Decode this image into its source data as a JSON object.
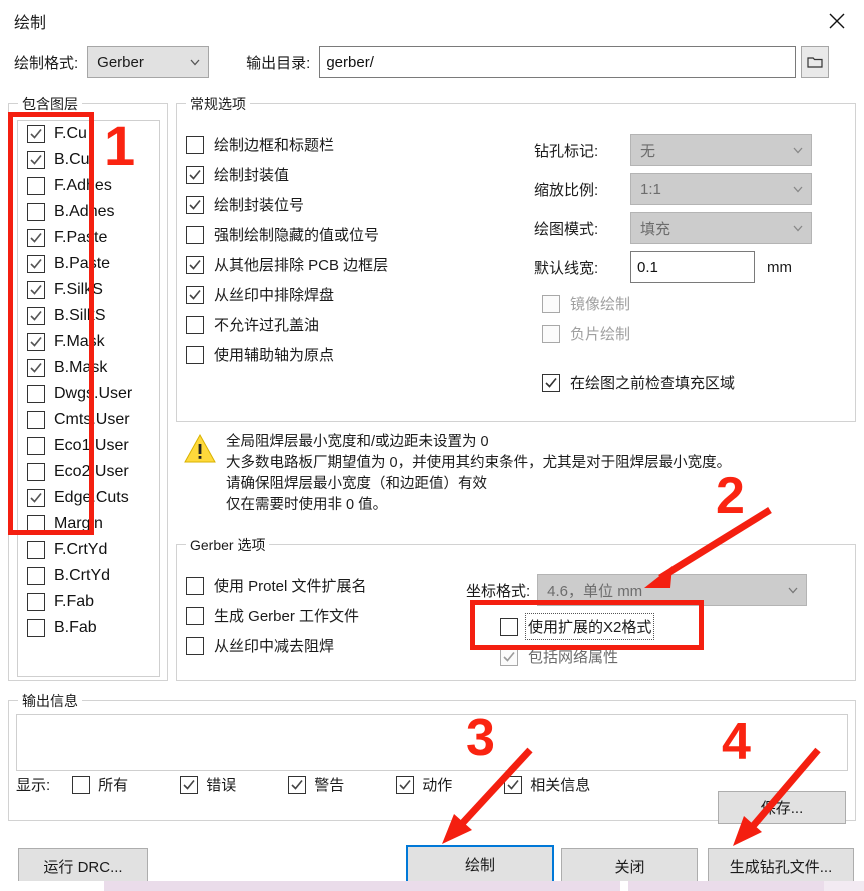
{
  "window": {
    "title": "绘制",
    "close_icon": "close-icon"
  },
  "top": {
    "format_label": "绘制格式:",
    "format_value": "Gerber",
    "output_dir_label": "输出目录:",
    "output_dir_value": "gerber/",
    "browse_icon": "folder-icon"
  },
  "layers": {
    "group_label": "包含图层",
    "items": [
      {
        "label": "F.Cu",
        "checked": true
      },
      {
        "label": "B.Cu",
        "checked": true
      },
      {
        "label": "F.Adhes",
        "checked": false
      },
      {
        "label": "B.Adhes",
        "checked": false
      },
      {
        "label": "F.Paste",
        "checked": true
      },
      {
        "label": "B.Paste",
        "checked": true
      },
      {
        "label": "F.SilkS",
        "checked": true
      },
      {
        "label": "B.SilkS",
        "checked": true
      },
      {
        "label": "F.Mask",
        "checked": true
      },
      {
        "label": "B.Mask",
        "checked": true
      },
      {
        "label": "Dwgs.User",
        "checked": false
      },
      {
        "label": "Cmts.User",
        "checked": false
      },
      {
        "label": "Eco1.User",
        "checked": false
      },
      {
        "label": "Eco2.User",
        "checked": false
      },
      {
        "label": "Edge.Cuts",
        "checked": true
      },
      {
        "label": "Margin",
        "checked": false
      },
      {
        "label": "F.CrtYd",
        "checked": false
      },
      {
        "label": "B.CrtYd",
        "checked": false
      },
      {
        "label": "F.Fab",
        "checked": false
      },
      {
        "label": "B.Fab",
        "checked": false
      }
    ]
  },
  "general": {
    "group_label": "常规选项",
    "options": [
      {
        "label": "绘制边框和标题栏",
        "checked": false,
        "disabled": false
      },
      {
        "label": "绘制封装值",
        "checked": true,
        "disabled": false
      },
      {
        "label": "绘制封装位号",
        "checked": true,
        "disabled": false
      },
      {
        "label": "强制绘制隐藏的值或位号",
        "checked": false,
        "disabled": false
      },
      {
        "label": "从其他层排除 PCB 边框层",
        "checked": true,
        "disabled": false
      },
      {
        "label": "从丝印中排除焊盘",
        "checked": true,
        "disabled": false
      },
      {
        "label": "不允许过孔盖油",
        "checked": false,
        "disabled": false
      },
      {
        "label": "使用辅助轴为原点",
        "checked": false,
        "disabled": false
      }
    ],
    "drill_marks_label": "钻孔标记:",
    "drill_marks_value": "无",
    "scaling_label": "缩放比例:",
    "scaling_value": "1:1",
    "plot_mode_label": "绘图模式:",
    "plot_mode_value": "填充",
    "line_width_label": "默认线宽:",
    "line_width_value": "0.1",
    "line_width_unit": "mm",
    "mirror_label": "镜像绘制",
    "mirror_checked": false,
    "negative_label": "负片绘制",
    "negative_checked": false,
    "check_zones_label": "在绘图之前检查填充区域",
    "check_zones_checked": true
  },
  "warning": {
    "icon": "warning-icon",
    "lines": [
      "全局阻焊层最小宽度和/或边距未设置为 0",
      "大多数电路板厂期望值为 0，并使用其约束条件，尤其是对于阻焊层最小宽度。",
      "请确保阻焊层最小宽度（和边距值）有效",
      "仅在需要时使用非 0 值。"
    ]
  },
  "gerber": {
    "group_label": "Gerber 选项",
    "options": [
      {
        "label": "使用 Protel 文件扩展名",
        "checked": false
      },
      {
        "label": "生成 Gerber 工作文件",
        "checked": false
      },
      {
        "label": "从丝印中减去阻焊",
        "checked": false
      }
    ],
    "coord_format_label": "坐标格式:",
    "coord_format_value": "4.6，单位 mm",
    "x2_label": "使用扩展的X2格式",
    "x2_checked": false,
    "netlist_attr_label": "包括网络属性",
    "netlist_attr_checked": true
  },
  "messages": {
    "group_label": "输出信息",
    "body": "",
    "show_label": "显示:",
    "filters": [
      {
        "label": "所有",
        "checked": false
      },
      {
        "label": "错误",
        "checked": true
      },
      {
        "label": "警告",
        "checked": true
      },
      {
        "label": "动作",
        "checked": true
      },
      {
        "label": "相关信息",
        "checked": true
      }
    ],
    "save_label": "保存..."
  },
  "buttons": {
    "run_drc": "运行 DRC...",
    "plot": "绘制",
    "close": "关闭",
    "gen_drill": "生成钻孔文件..."
  },
  "annotations": {
    "color": "#fa2411",
    "marks": [
      {
        "number": "1",
        "target": "layers-list"
      },
      {
        "number": "2",
        "target": "x2-format-checkbox"
      },
      {
        "number": "3",
        "target": "plot-button"
      },
      {
        "number": "4",
        "target": "generate-drill-file-button"
      }
    ]
  }
}
